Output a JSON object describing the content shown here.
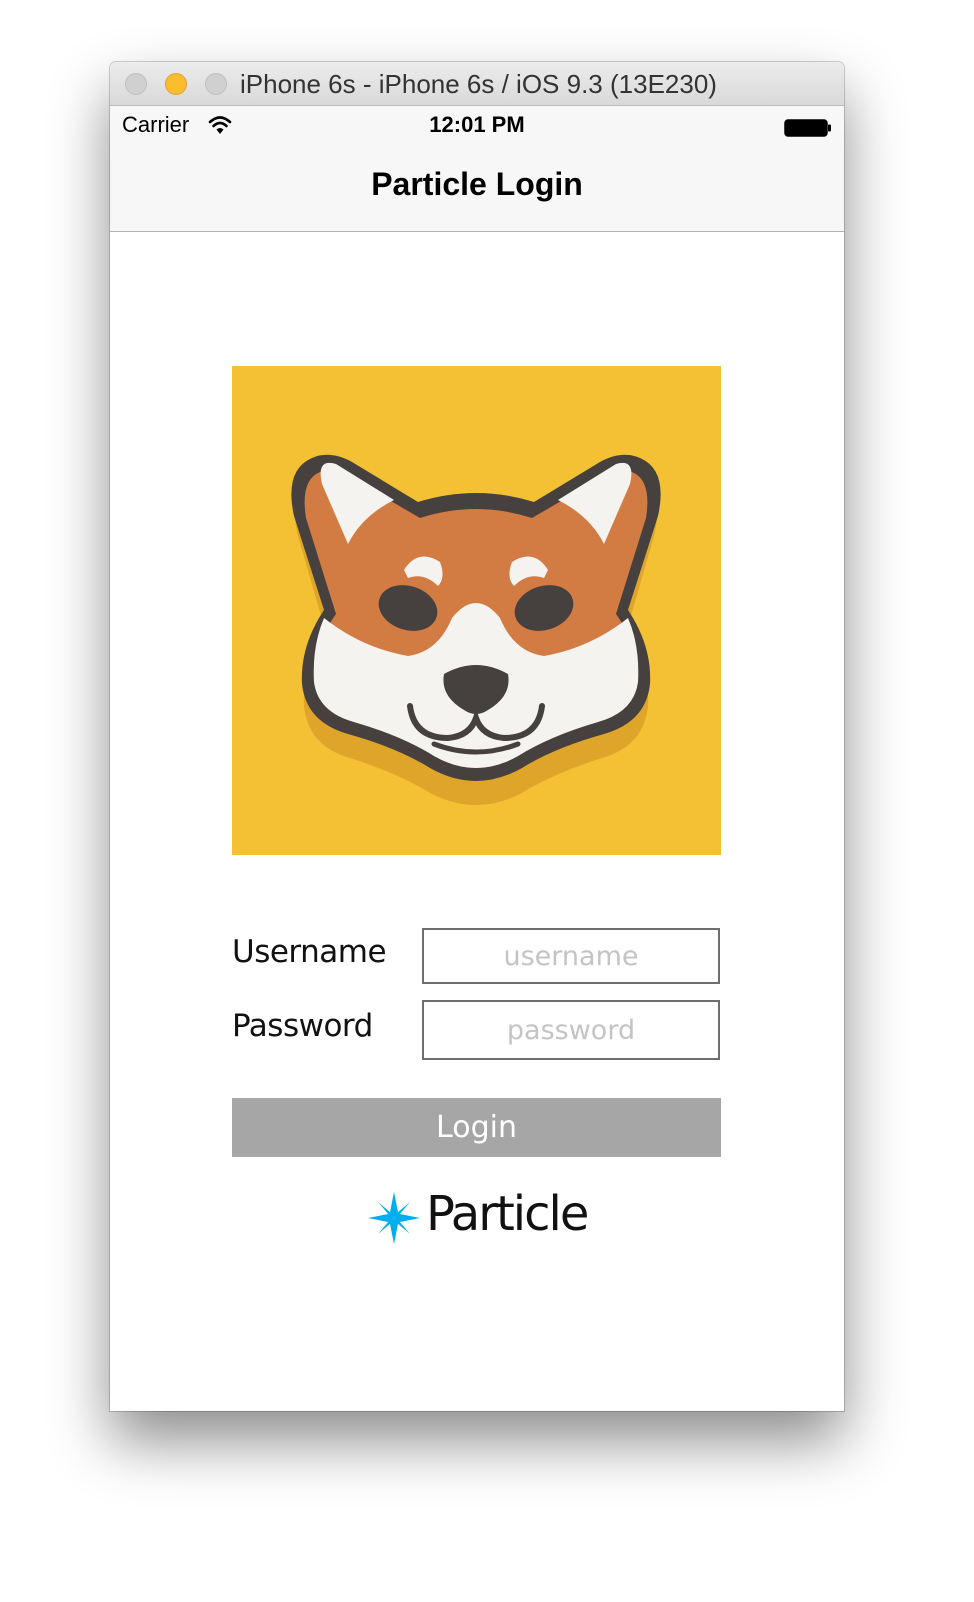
{
  "window": {
    "title": "iPhone 6s - iPhone 6s / iOS 9.3 (13E230)"
  },
  "status_bar": {
    "carrier": "Carrier",
    "time": "12:01 PM",
    "icons": [
      "wifi-icon",
      "battery-icon"
    ]
  },
  "nav_bar": {
    "title": "Particle Login"
  },
  "hero_image": {
    "icon": "shiba-dog-face-icon",
    "background_color": "#f3c133"
  },
  "form": {
    "username_label": "Username",
    "username_placeholder": "username",
    "username_value": "",
    "password_label": "Password",
    "password_placeholder": "password",
    "password_value": "",
    "login_label": "Login",
    "login_button_color": "#a6a6a6"
  },
  "footer": {
    "brand": "Particle",
    "brand_icon": "particle-star-icon",
    "brand_color": "#00aeef"
  }
}
